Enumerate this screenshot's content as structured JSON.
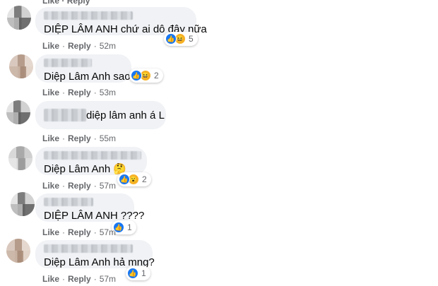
{
  "comments": [
    {
      "text": "DIỆP LÂM ANH chứ ai dô đây nữa",
      "like_label": "Like",
      "reply_label": "Reply",
      "time": "52m",
      "reaction_types": [
        "like-icon",
        "haha-icon"
      ],
      "reaction_count": "5"
    },
    {
      "text": "Diệp Lâm Anh saoo",
      "like_label": "Like",
      "reply_label": "Reply",
      "time": "53m",
      "reaction_types": [
        "like-icon",
        "haha-icon"
      ],
      "reaction_count": "2"
    },
    {
      "text": "diệp lâm anh á L",
      "like_label": "Like",
      "reply_label": "Reply",
      "time": "55m",
      "reaction_types": [],
      "reaction_count": ""
    },
    {
      "text": "Diệp Lâm Anh 🤔",
      "like_label": "Like",
      "reply_label": "Reply",
      "time": "57m",
      "reaction_types": [
        "like-icon",
        "wow-icon"
      ],
      "reaction_count": "2"
    },
    {
      "text": "DIỆP LÂM ANH ????",
      "like_label": "Like",
      "reply_label": "Reply",
      "time": "57m",
      "reaction_types": [
        "like-icon"
      ],
      "reaction_count": "1"
    },
    {
      "text": "Diệp Lâm Anh hả mng?",
      "like_label": "Like",
      "reply_label": "Reply",
      "time": "57m",
      "reaction_types": [
        "like-icon"
      ],
      "reaction_count": "1"
    }
  ],
  "top_cut": {
    "like_label": "Like",
    "reply_label": "Reply"
  },
  "colors": {
    "accent": "#1877f2",
    "bubble": "#f0f2f5",
    "meta": "#65676b"
  }
}
